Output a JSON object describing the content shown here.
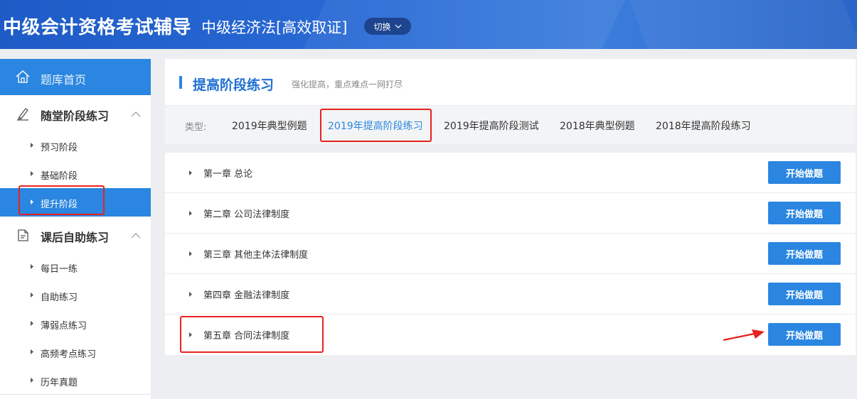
{
  "header": {
    "brand": "中级会计资格考试辅导",
    "course": "中级经济法[高效取证]",
    "switch_label": "切换"
  },
  "sidebar": {
    "home_label": "题库首页",
    "groups": [
      {
        "label": "随堂阶段练习",
        "items": [
          "预习阶段",
          "基础阶段",
          "提升阶段"
        ],
        "active_index": 2
      },
      {
        "label": "课后自助练习",
        "items": [
          "每日一练",
          "自助练习",
          "薄弱点练习",
          "高频考点练习",
          "历年真题"
        ]
      }
    ]
  },
  "main": {
    "title": "提高阶段练习",
    "subtitle": "强化提高，重点难点一网打尽",
    "filter_label": "类型:",
    "filters": [
      "2019年典型例题",
      "2019年提高阶段练习",
      "2019年提高阶段测试",
      "2018年典型例题",
      "2018年提高阶段练习"
    ],
    "active_filter_index": 1,
    "chapters": [
      "第一章 总论",
      "第二章 公司法律制度",
      "第三章 其他主体法律制度",
      "第四章 金融法律制度",
      "第五章 合同法律制度"
    ],
    "start_label": "开始做题"
  },
  "colors": {
    "header_blue": "#2a6bd6",
    "accent": "#2a86e0",
    "annotation_red": "#e8221f"
  }
}
